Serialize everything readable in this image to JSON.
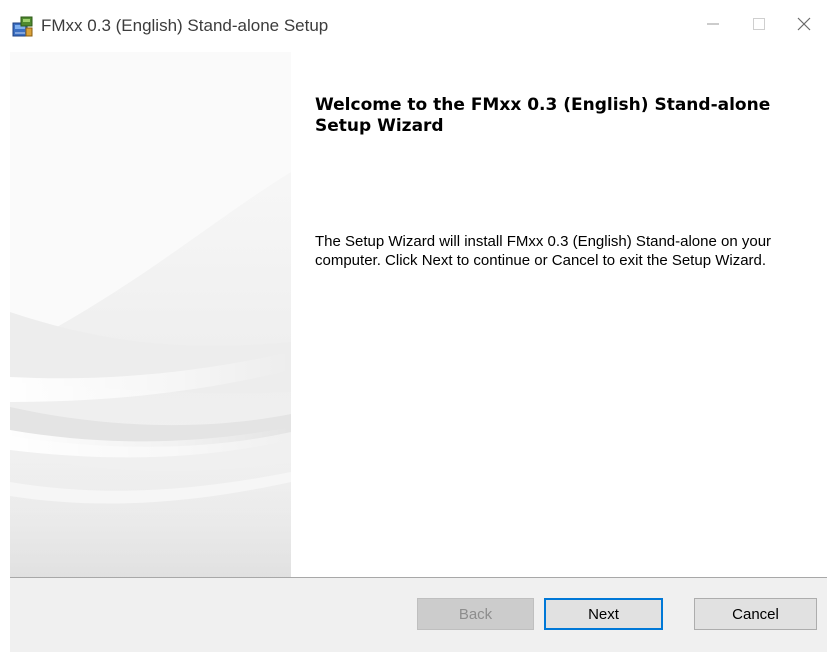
{
  "window": {
    "title": "FMxx 0.3 (English) Stand-alone Setup",
    "icon": "installer-box-icon",
    "controls": {
      "minimize": "—",
      "maximize": "☐",
      "close": "✕"
    }
  },
  "content": {
    "heading": "Welcome to the FMxx 0.3 (English) Stand-alone Setup Wizard",
    "body": "The Setup Wizard will install FMxx 0.3 (English) Stand-alone on your computer. Click Next to continue or Cancel to exit the Setup Wizard."
  },
  "buttons": {
    "back": "Back",
    "next": "Next",
    "cancel": "Cancel",
    "back_enabled": false
  },
  "colors": {
    "accent": "#0078d7",
    "footer_bg": "#f0f0f0",
    "button_bg": "#e1e1e1",
    "disabled_text": "#8d8d8d"
  }
}
